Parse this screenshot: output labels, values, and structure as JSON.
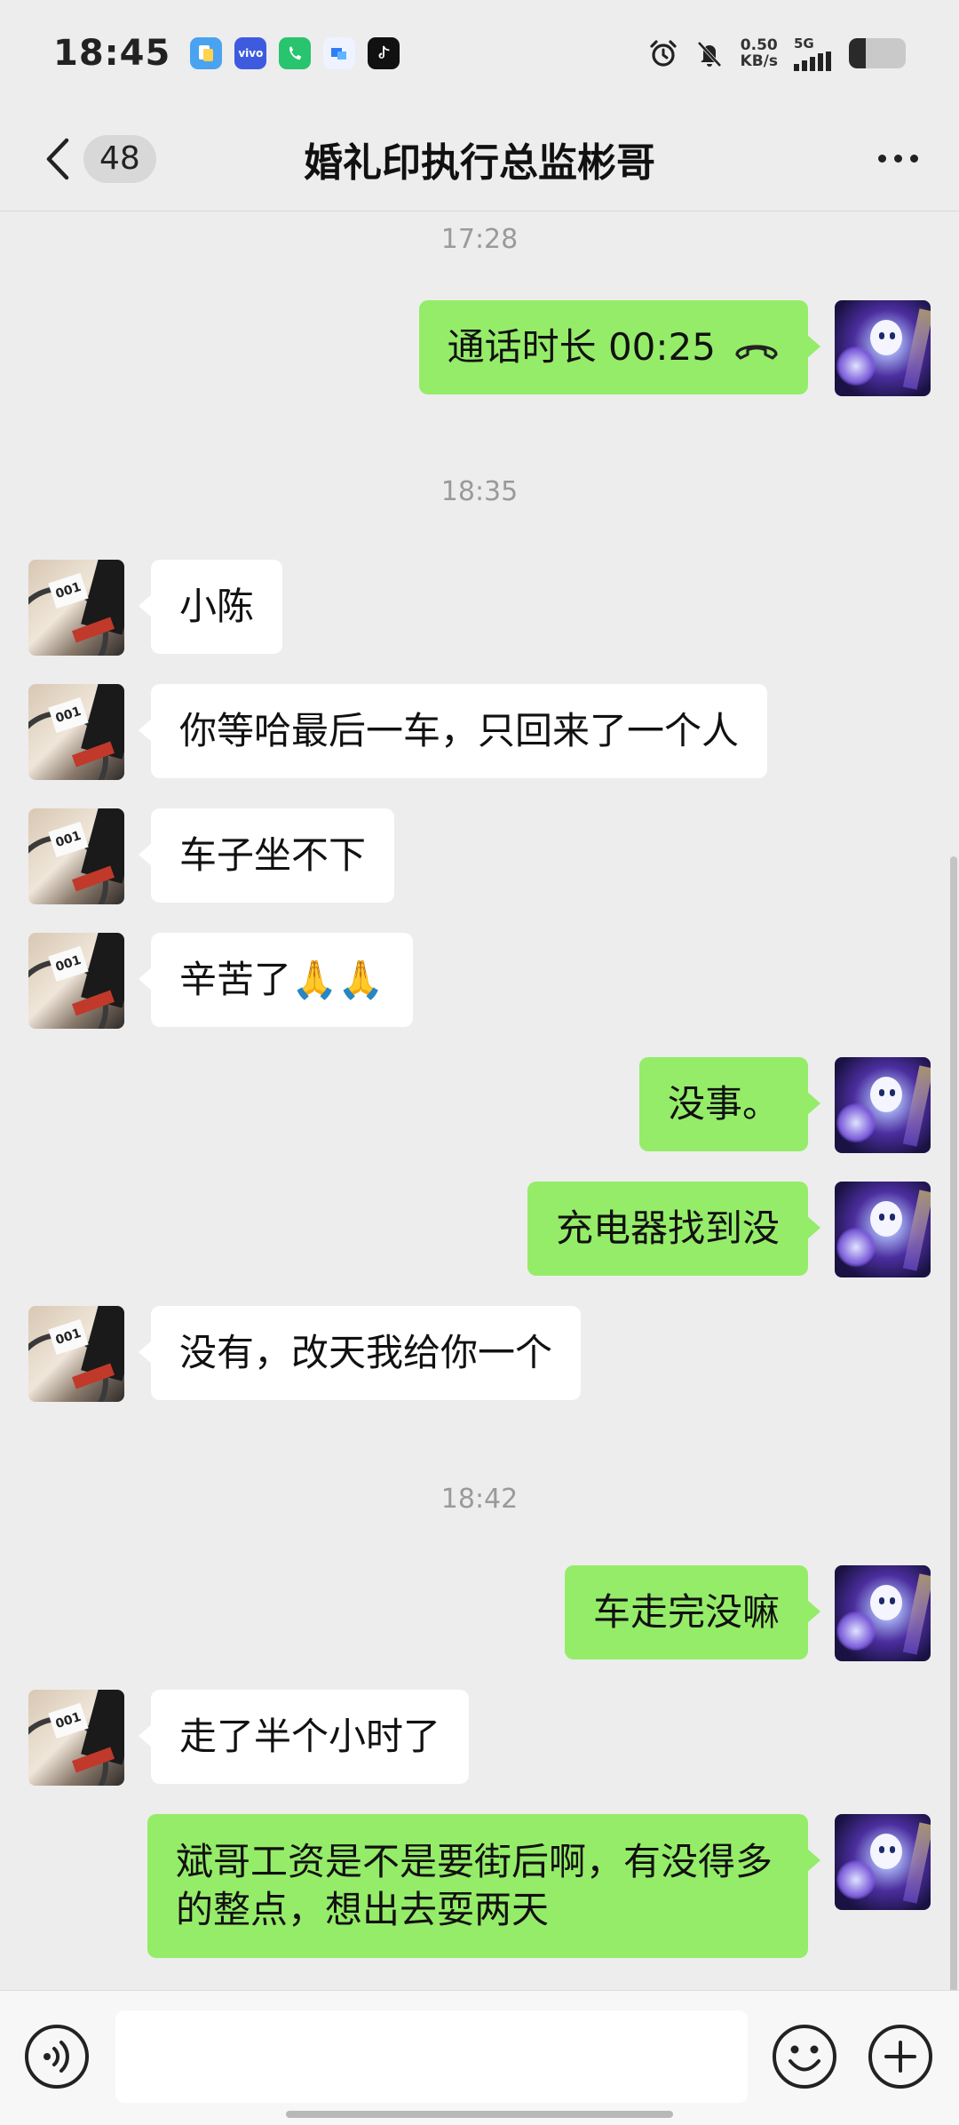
{
  "status_bar": {
    "time": "18:45",
    "network_speed_value": "0.50",
    "network_speed_unit": "KB/s",
    "network_type": "5G",
    "app_icons": [
      "files-app-icon",
      "vivo-app-icon",
      "phone-app-icon",
      "browser-app-icon",
      "tiktok-app-icon"
    ],
    "battery_level": 0.3
  },
  "header": {
    "unread_count": "48",
    "title": "婚礼印执行总监彬哥"
  },
  "messages": [
    {
      "type": "time",
      "text": "17:28"
    },
    {
      "type": "call",
      "side": "right",
      "text": "通话时长 00:25"
    },
    {
      "type": "time",
      "text": "18:35"
    },
    {
      "type": "text",
      "side": "left",
      "text": "小陈"
    },
    {
      "type": "text",
      "side": "left",
      "text": "你等哈最后一车，只回来了一个人"
    },
    {
      "type": "text",
      "side": "left",
      "text": "车子坐不下"
    },
    {
      "type": "text",
      "side": "left",
      "text": "辛苦了🙏🙏"
    },
    {
      "type": "text",
      "side": "right",
      "text": "没事。"
    },
    {
      "type": "text",
      "side": "right",
      "text": "充电器找到没"
    },
    {
      "type": "text",
      "side": "left",
      "text": "没有，改天我给你一个"
    },
    {
      "type": "time",
      "text": "18:42"
    },
    {
      "type": "text",
      "side": "right",
      "text": "车走完没嘛"
    },
    {
      "type": "text",
      "side": "left",
      "text": "走了半个小时了"
    },
    {
      "type": "text",
      "side": "right",
      "text": "斌哥工资是不是要街后啊，有没得多的整点，想出去耍两天"
    }
  ],
  "input_bar": {
    "voice_icon": "voice-icon",
    "emoji_icon": "emoji-icon",
    "plus_icon": "plus-icon"
  },
  "colors": {
    "background": "#ededed",
    "my_bubble": "#95ec69",
    "their_bubble": "#ffffff"
  }
}
